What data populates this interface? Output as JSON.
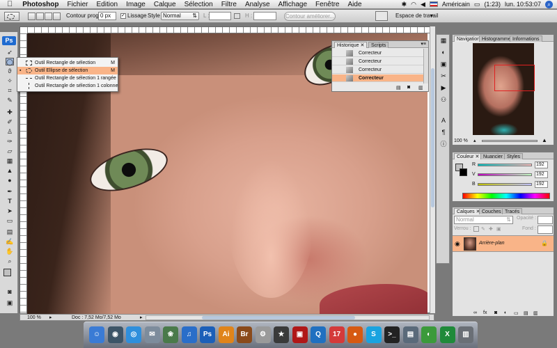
{
  "menubar": {
    "app": "Photoshop",
    "items": [
      "Fichier",
      "Edition",
      "Image",
      "Calque",
      "Sélection",
      "Filtre",
      "Analyse",
      "Affichage",
      "Fenêtre",
      "Aide"
    ],
    "locale": "Américain",
    "battery": "(1:23)",
    "clock": "lun. 10:53:07"
  },
  "options": {
    "feather_label": "Contour progr. :",
    "feather_value": "0 px",
    "antialias_label": "Lissage",
    "style_label": "Style :",
    "style_value": "Normal",
    "w_label": "L :",
    "h_label": "H :",
    "refine_label": "Contour améliorer...",
    "workspace_label": "Espace de travail"
  },
  "toolbox": {
    "logo": "Ps"
  },
  "flyout": {
    "items": [
      {
        "label": "Outil Rectangle de sélection",
        "key": "M"
      },
      {
        "label": "Outil Ellipse de sélection",
        "key": "M"
      },
      {
        "label": "Outil Rectangle de sélection 1 rangée",
        "key": ""
      },
      {
        "label": "Outil Rectangle de sélection 1 colonne",
        "key": ""
      }
    ]
  },
  "history": {
    "tabs": [
      "Historique",
      "Scripts"
    ],
    "rows": [
      "Correcteur",
      "Correcteur",
      "Correcteur",
      "Correcteur"
    ]
  },
  "document": {
    "zoom": "100 %",
    "doc_info": "Doc : 7,52 Mo/7,52 Mo"
  },
  "navigator": {
    "tabs": [
      "Navigation",
      "Histogramme",
      "Informations"
    ],
    "zoom": "100 %"
  },
  "color": {
    "tabs": [
      "Couleur",
      "Nuancier",
      "Styles"
    ],
    "channels": [
      {
        "name": "R",
        "value": "192"
      },
      {
        "name": "V",
        "value": "192"
      },
      {
        "name": "B",
        "value": "192"
      }
    ],
    "swatch_fg": "#c0c0c0",
    "swatch_bg": "#000000"
  },
  "layers": {
    "tabs": [
      "Calques",
      "Couches",
      "Tracés"
    ],
    "blend": "Normal",
    "opacity_label": "Opacité :",
    "lock_label": "Verrou :",
    "fill_label": "Fond :",
    "layer_name": "Arrière-plan"
  },
  "dock": {
    "apps": [
      {
        "name": "finder",
        "glyph": "☺",
        "color": "#3a7bd5"
      },
      {
        "name": "dashboard",
        "glyph": "◉",
        "color": "#3d5568"
      },
      {
        "name": "safari",
        "glyph": "◎",
        "color": "#2f8fdc"
      },
      {
        "name": "mail",
        "glyph": "✉",
        "color": "#7d8c9c"
      },
      {
        "name": "iphoto",
        "glyph": "❀",
        "color": "#4a7a4a"
      },
      {
        "name": "itunes",
        "glyph": "♫",
        "color": "#2a6ec9"
      },
      {
        "name": "photoshop",
        "glyph": "Ps",
        "color": "#1c5fb8"
      },
      {
        "name": "illustrator",
        "glyph": "Ai",
        "color": "#e0841a"
      },
      {
        "name": "bridge",
        "glyph": "Br",
        "color": "#8a4a1a"
      },
      {
        "name": "automator",
        "glyph": "⚙",
        "color": "#9a9a9a"
      },
      {
        "name": "imovie",
        "glyph": "★",
        "color": "#3a3a3a"
      },
      {
        "name": "photobooth",
        "glyph": "▣",
        "color": "#b01818"
      },
      {
        "name": "quicktime",
        "glyph": "Q",
        "color": "#2070c0"
      },
      {
        "name": "ical",
        "glyph": "17",
        "color": "#d43a3a"
      },
      {
        "name": "firefox",
        "glyph": "●",
        "color": "#d65a12"
      },
      {
        "name": "skype",
        "glyph": "S",
        "color": "#19a3e0"
      },
      {
        "name": "terminal",
        "glyph": ">_",
        "color": "#222"
      },
      {
        "name": "network",
        "glyph": "▤",
        "color": "#5a6a7a"
      },
      {
        "name": "chrome",
        "glyph": "◐",
        "color": "#3b9a3b"
      },
      {
        "name": "excel",
        "glyph": "X",
        "color": "#1f8a3a"
      },
      {
        "name": "trash",
        "glyph": "▥",
        "color": "#6a6f76"
      }
    ]
  }
}
